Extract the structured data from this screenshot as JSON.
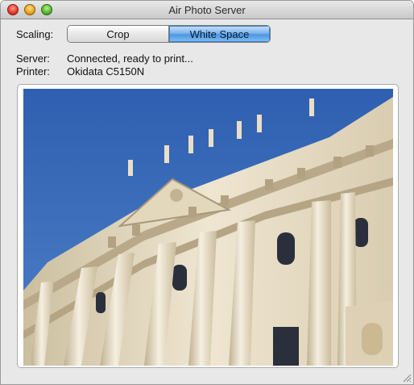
{
  "window": {
    "title": "Air Photo Server",
    "controls": {
      "close": "close-icon",
      "minimize": "minimize-icon",
      "zoom": "zoom-icon"
    }
  },
  "scaling": {
    "label": "Scaling:",
    "options": [
      "Crop",
      "White Space"
    ],
    "selected": "White Space"
  },
  "server": {
    "label": "Server:",
    "value": "Connected, ready to print..."
  },
  "printer": {
    "label": "Printer:",
    "value": "Okidata C5150N"
  },
  "photo": {
    "icon": "photo-preview"
  },
  "colors": {
    "accent": "#5a9ce6",
    "sky": "#3b6db8",
    "stone": "#e8dcc4"
  }
}
